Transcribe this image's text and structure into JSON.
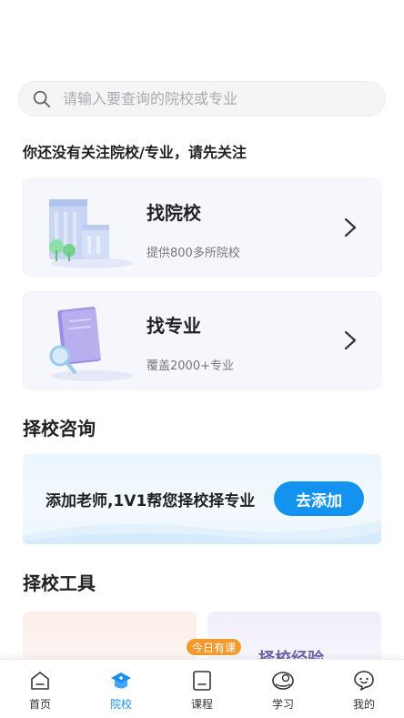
{
  "search": {
    "placeholder": "请输入要查询的院校或专业"
  },
  "notice": "你还没有关注院校/专业，请先关注",
  "cards": [
    {
      "title": "找院校",
      "subtitle": "提供800多所院校"
    },
    {
      "title": "找专业",
      "subtitle": "覆盖2000+专业"
    }
  ],
  "consult": {
    "section_title": "择校咨询",
    "text": "添加老师,1V1帮您择校择专业",
    "button": "去添加"
  },
  "tools": {
    "section_title": "择校工具",
    "card_b_label": "择校经验"
  },
  "tabbar": {
    "badge": "今日有课",
    "active_color": "#1d8ff0",
    "items": [
      {
        "label": "首页",
        "icon": "home-icon"
      },
      {
        "label": "院校",
        "icon": "college-cap-icon"
      },
      {
        "label": "课程",
        "icon": "course-icon"
      },
      {
        "label": "学习",
        "icon": "study-icon"
      },
      {
        "label": "我的",
        "icon": "profile-icon"
      }
    ]
  }
}
